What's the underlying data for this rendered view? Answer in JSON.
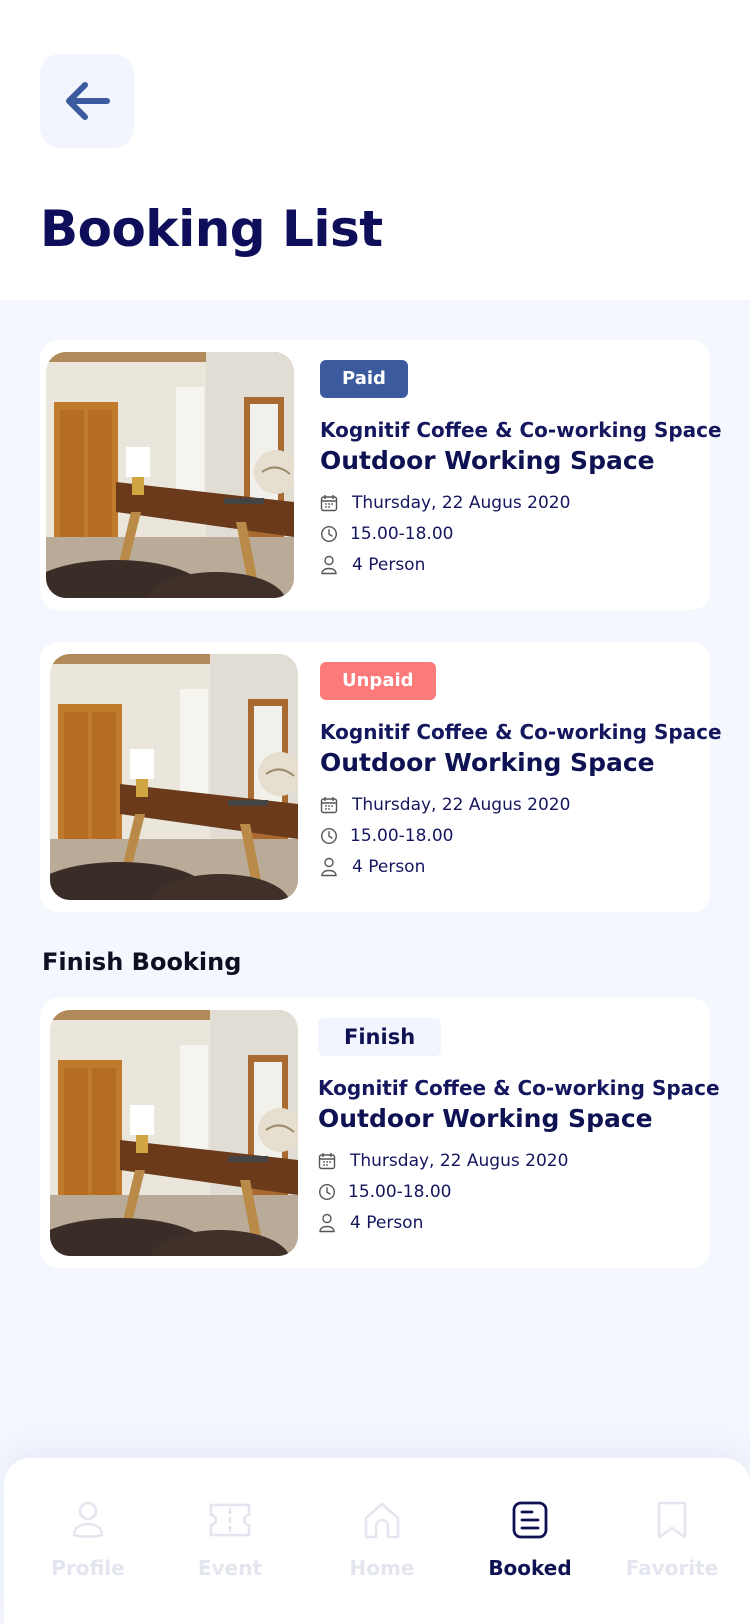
{
  "header": {
    "title": "Booking List"
  },
  "bookings": [
    {
      "status": "Paid",
      "venue": "Kognitif Coffee & Co-working Space",
      "space": "Outdoor Working Space",
      "date": "Thursday, 22 Augus 2020",
      "time": "15.00-18.00",
      "persons": "4 Person"
    },
    {
      "status": "Unpaid",
      "venue": "Kognitif Coffee & Co-working Space",
      "space": "Outdoor Working Space",
      "date": "Thursday, 22 Augus 2020",
      "time": "15.00-18.00",
      "persons": "4 Person"
    }
  ],
  "finish_section": {
    "title": "Finish Booking",
    "items": [
      {
        "status": "Finish",
        "venue": "Kognitif Coffee & Co-working Space",
        "space": "Outdoor Working Space",
        "date": "Thursday, 22 Augus 2020",
        "time": "15.00-18.00",
        "persons": "4 Person"
      }
    ]
  },
  "nav": {
    "items": [
      {
        "label": "Profile",
        "icon": "user-icon",
        "active": false
      },
      {
        "label": "Event",
        "icon": "ticket-icon",
        "active": false
      },
      {
        "label": "Home",
        "icon": "home-icon",
        "active": false
      },
      {
        "label": "Booked",
        "icon": "list-icon",
        "active": true
      },
      {
        "label": "Favorite",
        "icon": "bookmark-icon",
        "active": false
      }
    ]
  },
  "colors": {
    "primary": "#0e1152",
    "paid_badge": "#3b5b9e",
    "unpaid_badge": "#fd7a7a",
    "finish_badge": "#f2f5fd",
    "background": "#f4f7fe",
    "inactive_nav": "#e3e6ee"
  }
}
